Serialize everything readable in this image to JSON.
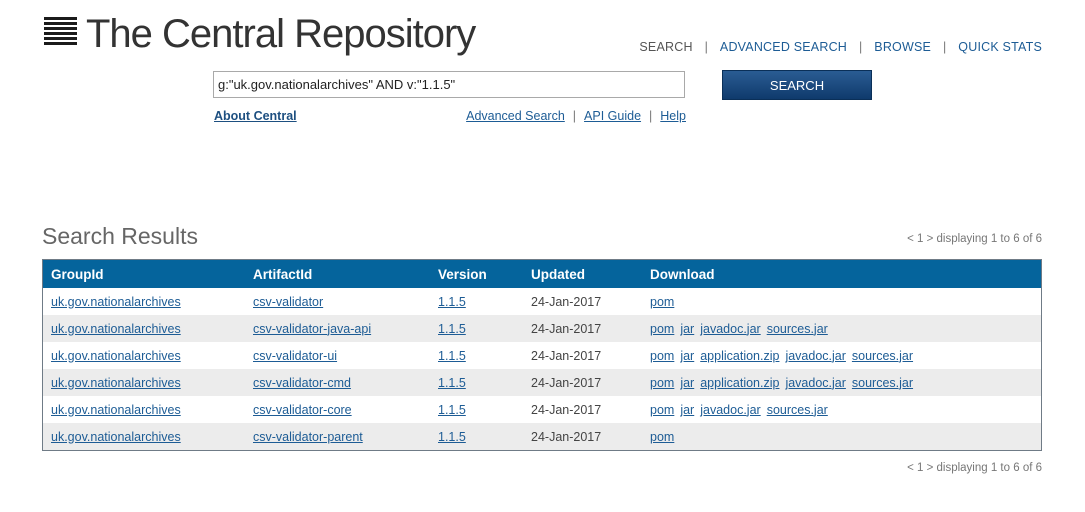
{
  "logo": {
    "title": "The Central Repository"
  },
  "nav": {
    "items": [
      {
        "label": "SEARCH",
        "link": false
      },
      {
        "label": "ADVANCED SEARCH",
        "link": true
      },
      {
        "label": "BROWSE",
        "link": true
      },
      {
        "label": "QUICK STATS",
        "link": true
      }
    ]
  },
  "search": {
    "value": "g:\"uk.gov.nationalarchives\" AND v:\"1.1.5\"",
    "button_label": "SEARCH"
  },
  "about_label": "About Central",
  "sublinks": [
    "Advanced Search",
    "API Guide",
    "Help"
  ],
  "results": {
    "title": "Search Results",
    "paging_top": "< 1 > displaying 1 to 6 of 6",
    "paging_bottom": "< 1 > displaying 1 to 6 of 6",
    "columns": [
      "GroupId",
      "ArtifactId",
      "Version",
      "Updated",
      "Download"
    ],
    "rows": [
      {
        "group": "uk.gov.nationalarchives",
        "artifact": "csv-validator",
        "version": "1.1.5",
        "updated": "24-Jan-2017",
        "downloads": [
          "pom"
        ]
      },
      {
        "group": "uk.gov.nationalarchives",
        "artifact": "csv-validator-java-api",
        "version": "1.1.5",
        "updated": "24-Jan-2017",
        "downloads": [
          "pom",
          "jar",
          "javadoc.jar",
          "sources.jar"
        ]
      },
      {
        "group": "uk.gov.nationalarchives",
        "artifact": "csv-validator-ui",
        "version": "1.1.5",
        "updated": "24-Jan-2017",
        "downloads": [
          "pom",
          "jar",
          "application.zip",
          "javadoc.jar",
          "sources.jar"
        ]
      },
      {
        "group": "uk.gov.nationalarchives",
        "artifact": "csv-validator-cmd",
        "version": "1.1.5",
        "updated": "24-Jan-2017",
        "downloads": [
          "pom",
          "jar",
          "application.zip",
          "javadoc.jar",
          "sources.jar"
        ]
      },
      {
        "group": "uk.gov.nationalarchives",
        "artifact": "csv-validator-core",
        "version": "1.1.5",
        "updated": "24-Jan-2017",
        "downloads": [
          "pom",
          "jar",
          "javadoc.jar",
          "sources.jar"
        ]
      },
      {
        "group": "uk.gov.nationalarchives",
        "artifact": "csv-validator-parent",
        "version": "1.1.5",
        "updated": "24-Jan-2017",
        "downloads": [
          "pom"
        ]
      }
    ]
  },
  "colors": {
    "header_bg": "#05649c",
    "button_bg": "#0f3a6c",
    "link": "#1d5c95",
    "alt_row": "#ececec"
  }
}
